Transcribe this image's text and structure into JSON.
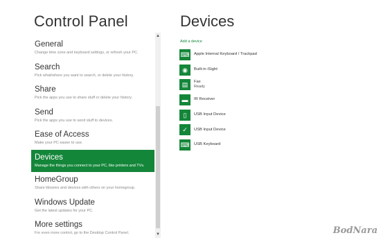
{
  "left_panel": {
    "title": "Control Panel",
    "items": [
      {
        "title": "General",
        "desc": "Change time zone and keyboard settings, or refresh your PC."
      },
      {
        "title": "Search",
        "desc": "Pick what/where you want to search, or delete your history."
      },
      {
        "title": "Share",
        "desc": "Pick the apps you use to share stuff or delete your history."
      },
      {
        "title": "Send",
        "desc": "Pick the apps you use to send stuff to devices."
      },
      {
        "title": "Ease of Access",
        "desc": "Make your PC easier to use."
      },
      {
        "title": "Devices",
        "desc": "Manage the things you connect to your PC, like printers and TVs."
      },
      {
        "title": "HomeGroup",
        "desc": "Share libraries and devices with others on your homegroup."
      },
      {
        "title": "Windows Update",
        "desc": "Get the latest updates for your PC."
      },
      {
        "title": "More settings",
        "desc": "For even more control, go to the Desktop Control Panel."
      }
    ],
    "selected_item": "Devices"
  },
  "scrollbar": {
    "up_icon": "up-arrow-icon",
    "down_icon": "down-arrow-icon"
  },
  "right_panel": {
    "title": "Devices",
    "add_device": "Add a device",
    "devices": [
      {
        "name": "Apple Internal Keyboard / Trackpad",
        "status": "",
        "icon": "keyboard-icon"
      },
      {
        "name": "Built-in iSight",
        "status": "",
        "icon": "webcam-icon"
      },
      {
        "name": "Fax",
        "status": "Ready",
        "icon": "fax-icon"
      },
      {
        "name": "IR Receiver",
        "status": "",
        "icon": "ir-receiver-icon"
      },
      {
        "name": "USB Input Device",
        "status": "",
        "icon": "usb-device-icon"
      },
      {
        "name": "USB Input Device",
        "status": "",
        "icon": "usb-device-icon"
      },
      {
        "name": "USB Keyboard",
        "status": "",
        "icon": "keyboard-icon"
      }
    ]
  },
  "watermark": "BodNara",
  "colors": {
    "accent": "#14863a",
    "background": "#ffffff",
    "text": "#333333"
  }
}
